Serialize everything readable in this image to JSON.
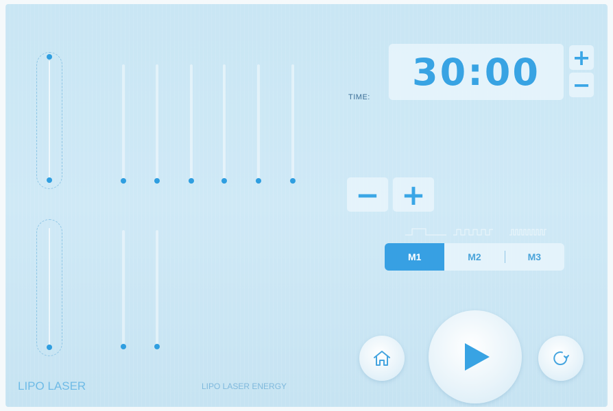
{
  "time": {
    "label": "TIME:",
    "value": "30:00",
    "plus": "+",
    "minus": "−"
  },
  "energy": {
    "minus": "−",
    "plus": "+"
  },
  "modes": {
    "items": [
      {
        "label": "M1",
        "active": true
      },
      {
        "label": "M2",
        "active": false
      },
      {
        "label": "M3",
        "active": false
      }
    ]
  },
  "labels": {
    "left": "LIPO LASER",
    "center": "LIPO LASER ENERGY"
  },
  "controls": {
    "home_icon": "home-icon",
    "play_icon": "play-icon",
    "reset_icon": "refresh-icon"
  },
  "colors": {
    "accent": "#37a0e3",
    "background": "#cfe9f6"
  }
}
